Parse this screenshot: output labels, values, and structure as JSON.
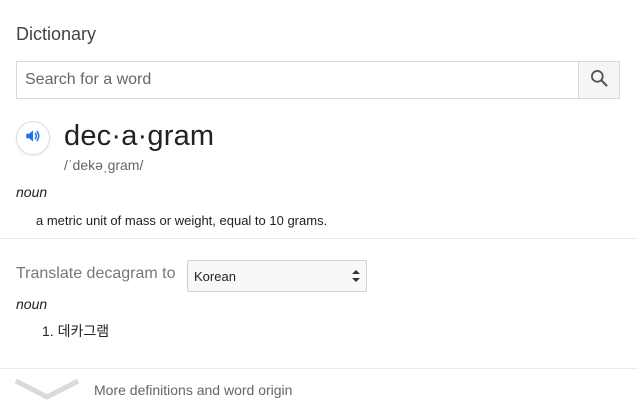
{
  "header": {
    "title": "Dictionary"
  },
  "search": {
    "placeholder": "Search for a word",
    "value": ""
  },
  "entry": {
    "word": "dec·a·gram",
    "pronunciation": "/ˈdekəˌɡram/",
    "part_of_speech": "noun",
    "definition": "a metric unit of mass or weight, equal to 10 grams."
  },
  "translate": {
    "label": "Translate decagram to",
    "selected_language": "Korean",
    "part_of_speech": "noun",
    "items": [
      "1. 데카그램"
    ]
  },
  "footer": {
    "more_label": "More definitions and word origin"
  },
  "colors": {
    "accent": "#1a73e8",
    "divider": "#ebebeb",
    "muted": "#777777"
  },
  "icons": {
    "search": "search-icon",
    "speaker": "speaker-icon",
    "select": "select-arrows-icon",
    "expand": "chevron-down-icon"
  }
}
